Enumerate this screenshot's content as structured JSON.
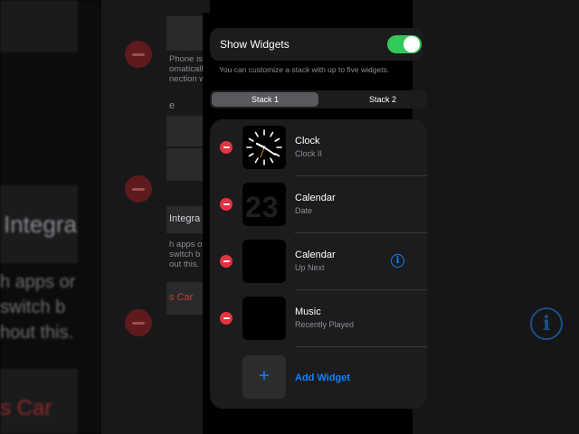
{
  "background": {
    "left_title": "Integra",
    "left_body_lines": [
      "h apps or",
      "switch b",
      "hout this."
    ],
    "left_car": "s Car",
    "mid_snippets": [
      "Phone is n",
      "omatically",
      "nection w"
    ],
    "mid_heading": "e",
    "mid_integra": "Integra",
    "mid_body_lines": [
      "h apps on",
      "switch b",
      "out this."
    ],
    "mid_car": "s Car"
  },
  "show_widgets": {
    "label": "Show Widgets",
    "enabled": true,
    "hint": "You can customize a stack with up to five widgets."
  },
  "stack_tabs": [
    "Stack 1",
    "Stack 2"
  ],
  "active_tab": "Stack 1",
  "widgets": [
    {
      "title": "Clock",
      "subtitle": "Clock II",
      "icon": "clock-face-icon"
    },
    {
      "title": "Calendar",
      "subtitle": "Date",
      "icon": "calendar-date-icon",
      "date_number": "23"
    },
    {
      "title": "Calendar",
      "subtitle": "Up Next",
      "icon": "calendar-up-next-icon",
      "has_info": true
    },
    {
      "title": "Music",
      "subtitle": "Recently Played",
      "icon": "music-icon"
    }
  ],
  "add_widget": {
    "label": "Add Widget",
    "icon": "plus-icon"
  },
  "info_glyph": "i",
  "plus_glyph": "+",
  "colors": {
    "accent_blue": "#0a84ff",
    "toggle_green": "#34c759",
    "delete_red": "#e8323f",
    "card_bg": "#1c1c1e"
  }
}
